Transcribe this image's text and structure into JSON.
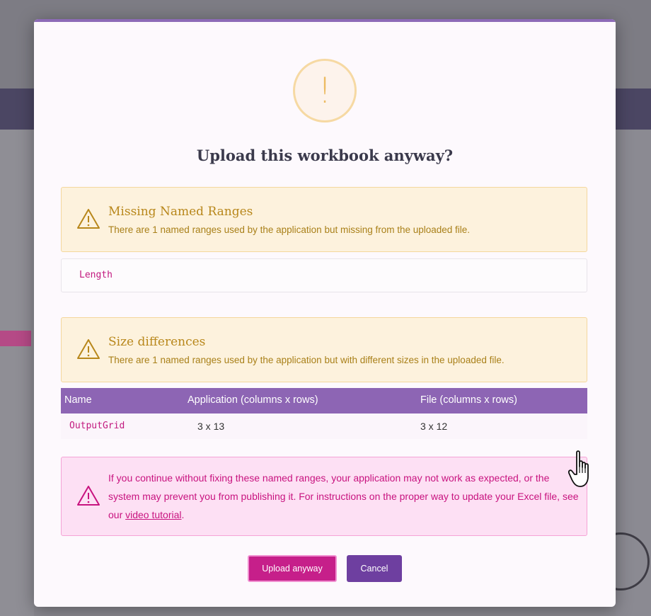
{
  "dialog": {
    "title": "Upload this workbook anyway?",
    "warning_glyph": "!"
  },
  "missing_ranges": {
    "title": "Missing Named Ranges",
    "text": "There are 1 named ranges used by the application but missing from the uploaded file.",
    "items": [
      "Length"
    ]
  },
  "size_differences": {
    "title": "Size differences",
    "text": "There are 1 named ranges used by the application but with different sizes in the uploaded file.",
    "columns": [
      "Name",
      "Application (columns x rows)",
      "File (columns x rows)"
    ],
    "rows": [
      {
        "name": "OutputGrid",
        "application": "3 x 13",
        "file": "3 x 12"
      }
    ]
  },
  "danger": {
    "text_before": "If you continue without fixing these named ranges, your application may not work as expected, or the system may prevent you from publishing it. For instructions on the proper way to update your Excel file, see our ",
    "link_text": "video tutorial",
    "text_after": "."
  },
  "buttons": {
    "upload": "Upload anyway",
    "cancel": "Cancel"
  },
  "colors": {
    "accent_purple": "#8d65b4",
    "warning": "#b8871b",
    "danger": "#c8137f",
    "upload_button": "#c61f8a",
    "cancel_button": "#6e3fa0"
  },
  "icons": [
    "warning-icon",
    "triangle-warning-icon",
    "hand-cursor-icon"
  ]
}
